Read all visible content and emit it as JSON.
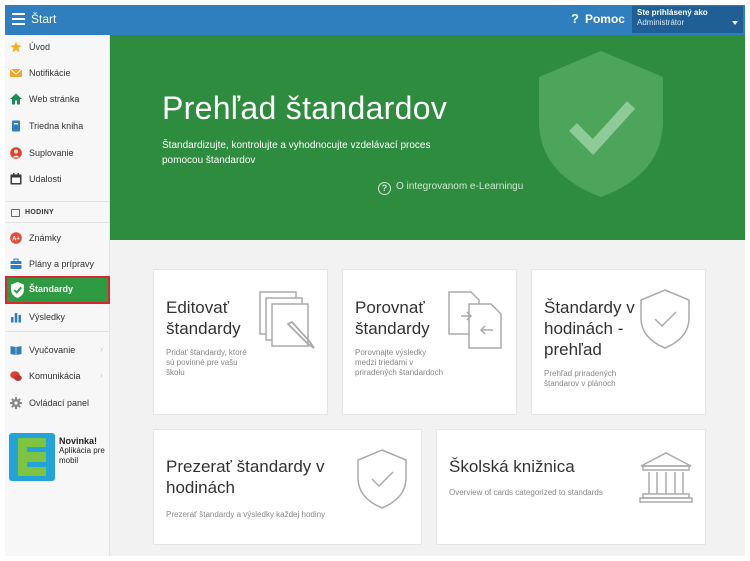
{
  "topbar": {
    "title": "Štart",
    "help_label": "Pomoc",
    "help_icon": "?",
    "user_line1": "Ste prihlásený ako",
    "user_line2": "Administrátor"
  },
  "sidebar": {
    "items": [
      {
        "label": "Úvod",
        "icon": "star-icon",
        "color": "#f2b417"
      },
      {
        "label": "Notifikácie",
        "icon": "envelope-icon",
        "color": "#f2a52f"
      },
      {
        "label": "Web stránka",
        "icon": "home-icon",
        "color": "#1f8a5a"
      },
      {
        "label": "Triedna kniha",
        "icon": "book-icon",
        "color": "#2f7fbf"
      },
      {
        "label": "Suplovanie",
        "icon": "person-icon",
        "color": "#d9432f"
      },
      {
        "label": "Udalosti",
        "icon": "calendar-icon",
        "color": "#3a3a3a"
      }
    ],
    "section_hodiny": "HODINY",
    "items2": [
      {
        "label": "Známky",
        "icon": "grades-icon",
        "color": "#e04e3a"
      },
      {
        "label": "Plány a prípravy",
        "icon": "briefcase-icon",
        "color": "#2f7fbf"
      },
      {
        "label": "Štandardy",
        "icon": "shield-check-icon",
        "color": "#ffffff"
      },
      {
        "label": "Výsledky",
        "icon": "bar-chart-icon",
        "color": "#2f7fbf"
      }
    ],
    "items3": [
      {
        "label": "Vyučovanie",
        "icon": "open-book-icon",
        "color": "#2f7fbf",
        "chevron": "›"
      },
      {
        "label": "Komunikácia",
        "icon": "chat-icon",
        "color": "#d9432f",
        "chevron": "›"
      },
      {
        "label": "Ovládací panel",
        "icon": "gear-icon",
        "color": "#888888"
      }
    ],
    "promo": {
      "title": "Novinka!",
      "text": "Aplikácia pre mobil"
    }
  },
  "hero": {
    "title": "Prehľad štandardov",
    "description": "Štandardizujte, kontrolujte a vyhodnocujte vzdelávací proces pomocou štandardov",
    "link_icon": "?",
    "link": "O integrovanom e-Learningu"
  },
  "cards": [
    {
      "title": "Editovať štandardy",
      "desc": "Pridať štandardy, ktoré sú povinné pre vašu školu",
      "icon": "edit-documents-icon"
    },
    {
      "title": "Porovnať štandardy",
      "desc": "Porovnajte výsledky medzi triedami v priradených štandardoch",
      "icon": "compare-documents-icon"
    },
    {
      "title": "Štandardy v hodinách - prehľad",
      "desc": "Prehľad priradených štandarov v plánoch",
      "icon": "shield-check-icon"
    },
    {
      "title": "Prezerať štandardy v hodinách",
      "desc": "Prezerať štandardy a výsledky každej hodiny",
      "icon": "shield-check-icon"
    },
    {
      "title": "Školská knižnica",
      "desc": "Overview of cards categorized to standards",
      "icon": "library-icon"
    }
  ],
  "colors": {
    "topbar": "#2f7fbf",
    "hero": "#2e8c3e",
    "active": "#2e9a41",
    "highlight": "#d9262f"
  }
}
